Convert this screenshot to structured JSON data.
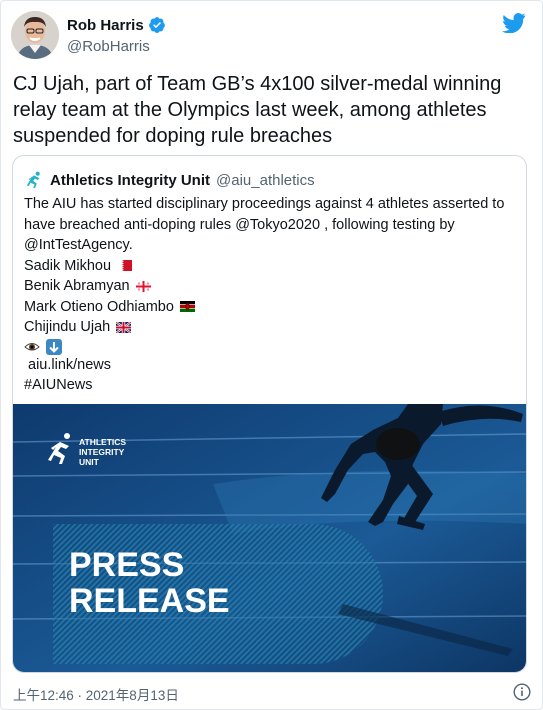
{
  "author": {
    "display_name": "Rob Harris",
    "handle": "@RobHarris",
    "avatar_icon": "person-avatar",
    "verified_icon": "verified-badge-icon"
  },
  "tweet": {
    "text": "CJ Ujah, part of Team GB’s 4x100 silver-medal winning relay team at the Olympics last week, among athletes suspended for doping rule breaches",
    "timestamp": "上午12:46 · 2021年8月13日"
  },
  "quoted": {
    "display_name": "Athletics Integrity Unit",
    "handle": "@aiu_athletics",
    "intro": "The AIU has started disciplinary proceedings against 4 athletes asserted to have breached anti-doping rules @Tokyo2020 , following testing by @IntTestAgency.",
    "athletes": [
      {
        "name": "Sadik Mikhou",
        "flag": "bahrain"
      },
      {
        "name": "Benik Abramyan",
        "flag": "georgia"
      },
      {
        "name": "Mark Otieno Odhiambo",
        "flag": "kenya"
      },
      {
        "name": "Chijindu Ujah",
        "flag": "uk"
      }
    ],
    "emoji_line_icons": [
      "eye-icon",
      "down-arrow-icon"
    ],
    "link": "aiu.link/news",
    "hashtag": "#AIUNews",
    "media": {
      "logo_line1": "ATHLETICS",
      "logo_line2": "INTEGRITY",
      "logo_line3": "UNIT",
      "headline1": "PRESS",
      "headline2": "RELEASE"
    }
  },
  "colors": {
    "twitter_blue": "#1d9bf0",
    "aiu_teal": "#26b3c9",
    "media_bg": "#1a4f8a"
  }
}
